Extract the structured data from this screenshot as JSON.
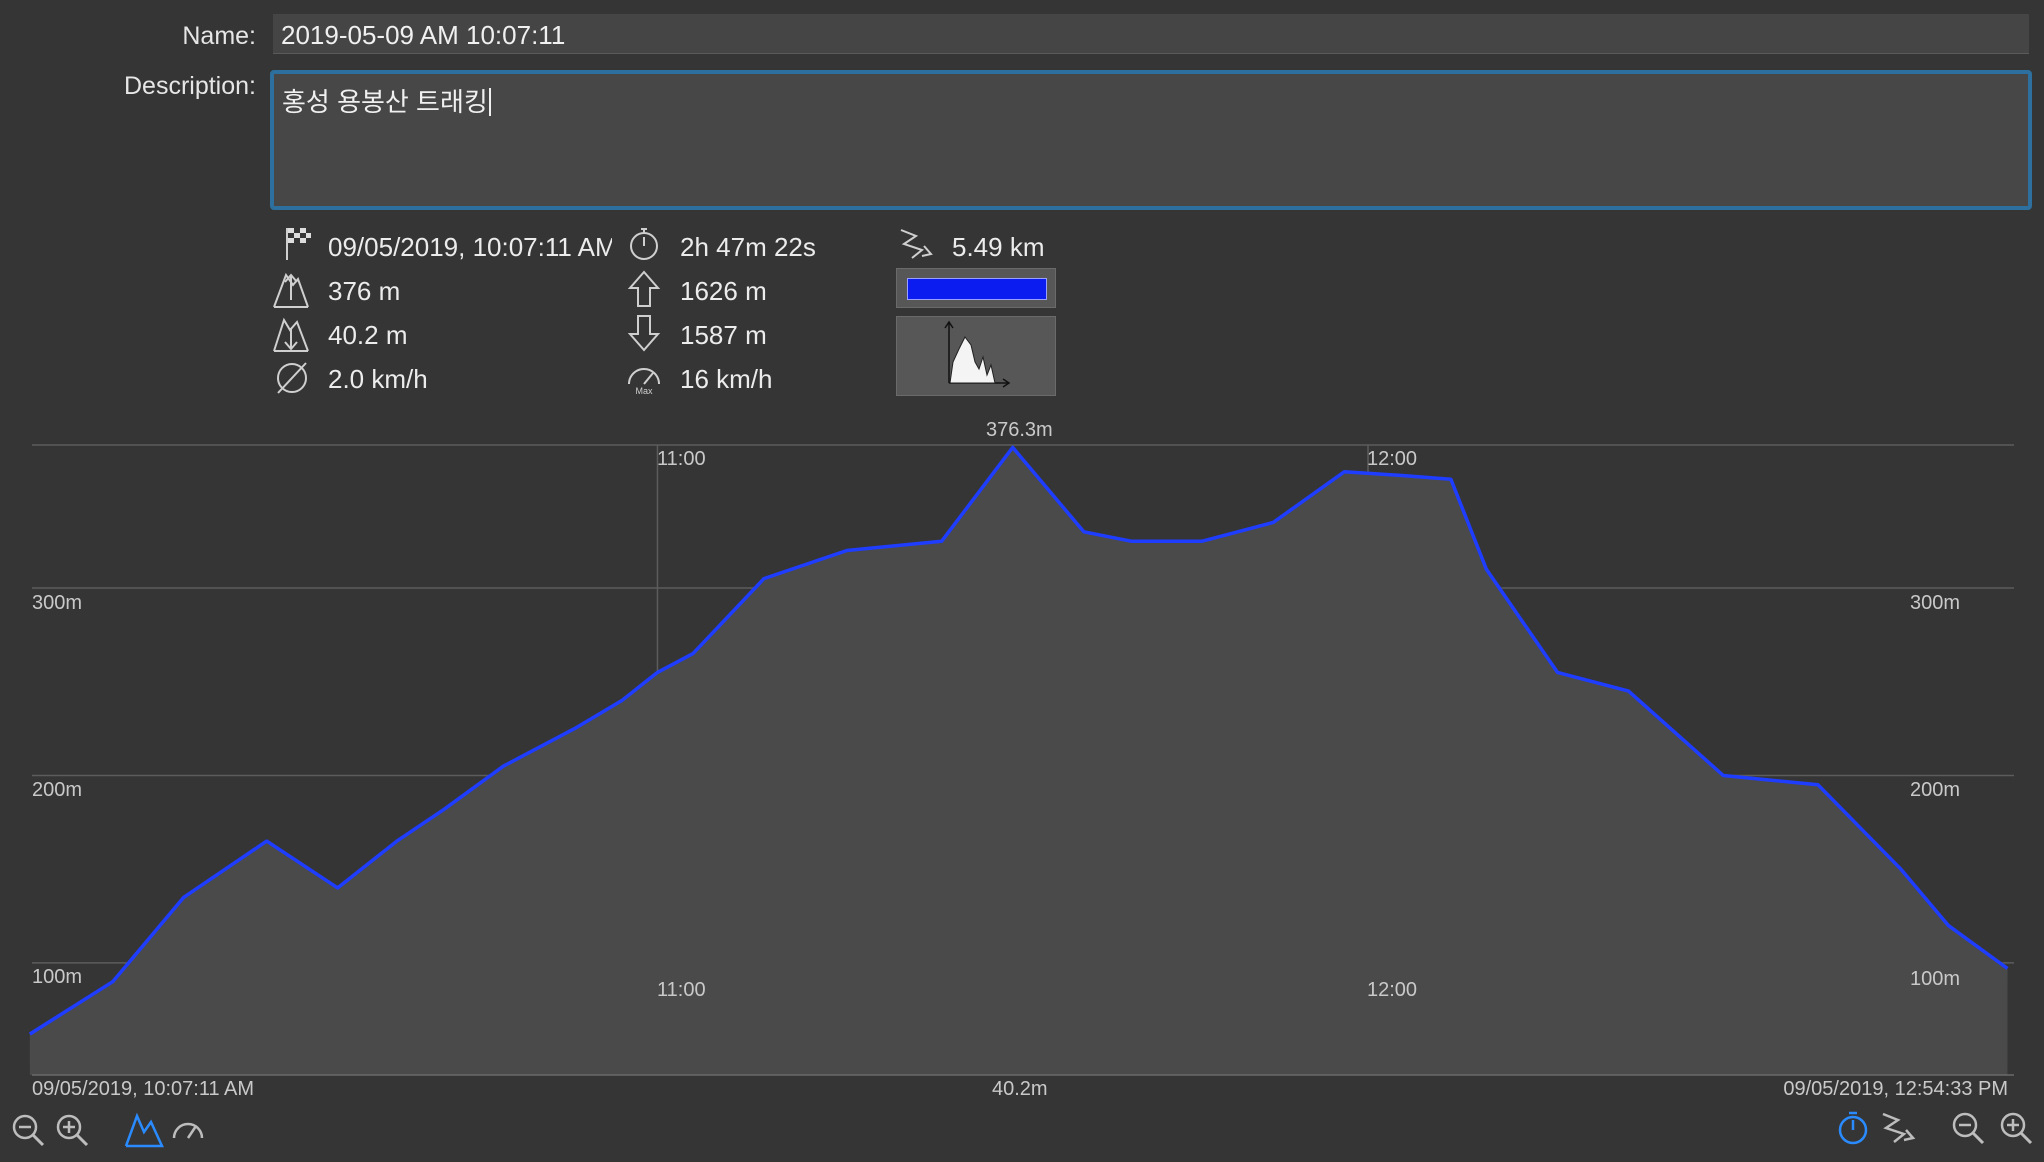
{
  "form": {
    "name_label": "Name:",
    "name_value": "2019-05-09 AM 10:07:11",
    "description_label": "Description:",
    "description_value": "홍성 용봉산 트래킹"
  },
  "stats": {
    "start_time": "09/05/2019, 10:07:11 AM",
    "duration": "2h 47m 22s",
    "distance": "5.49 km",
    "max_altitude": "376 m",
    "ascent": "1626 m",
    "min_altitude": "40.2 m",
    "descent": "1587 m",
    "avg_speed": "2.0 km/h",
    "max_speed": "16 km/h",
    "max_speed_icon_caption": "Max",
    "track_color": "#0a1cf0"
  },
  "chart_labels": {
    "peak": "376.3m",
    "min": "40.2m",
    "start": "09/05/2019, 10:07:11 AM",
    "end": "09/05/2019, 12:54:33 PM",
    "y_300": "300m",
    "y_200": "200m",
    "y_100": "100m",
    "t_11": "11:00",
    "t_12": "12:00"
  },
  "toolbar": {
    "left": [
      "zoom-out-icon",
      "zoom-in-icon",
      "elevation-icon",
      "speed-icon"
    ],
    "right": [
      "time-axis-icon",
      "distance-axis-icon",
      "zoom-out-icon",
      "zoom-in-icon"
    ]
  },
  "chart_data": {
    "type": "area",
    "xlabel": "",
    "ylabel": "",
    "x_range": [
      "10:07:11",
      "12:54:33"
    ],
    "ylim": [
      40.2,
      376.3
    ],
    "grid": true,
    "series": [
      {
        "color": "#1f3dff",
        "x": [
          "10:07",
          "10:14",
          "10:20",
          "10:27",
          "10:33",
          "10:38",
          "10:42",
          "10:47",
          "10:53",
          "10:57",
          "11:00",
          "11:03",
          "11:09",
          "11:16",
          "11:24",
          "11:30",
          "11:36",
          "11:40",
          "11:46",
          "11:52",
          "11:58",
          "12:03",
          "12:07",
          "12:10",
          "12:16",
          "12:22",
          "12:30",
          "12:38",
          "12:45",
          "12:49",
          "12:54"
        ],
        "y": [
          62,
          90,
          135,
          165,
          140,
          165,
          182,
          205,
          225,
          240,
          255,
          265,
          305,
          320,
          325,
          375,
          330,
          325,
          325,
          335,
          362,
          360,
          358,
          310,
          255,
          245,
          200,
          195,
          150,
          120,
          97
        ]
      }
    ]
  }
}
